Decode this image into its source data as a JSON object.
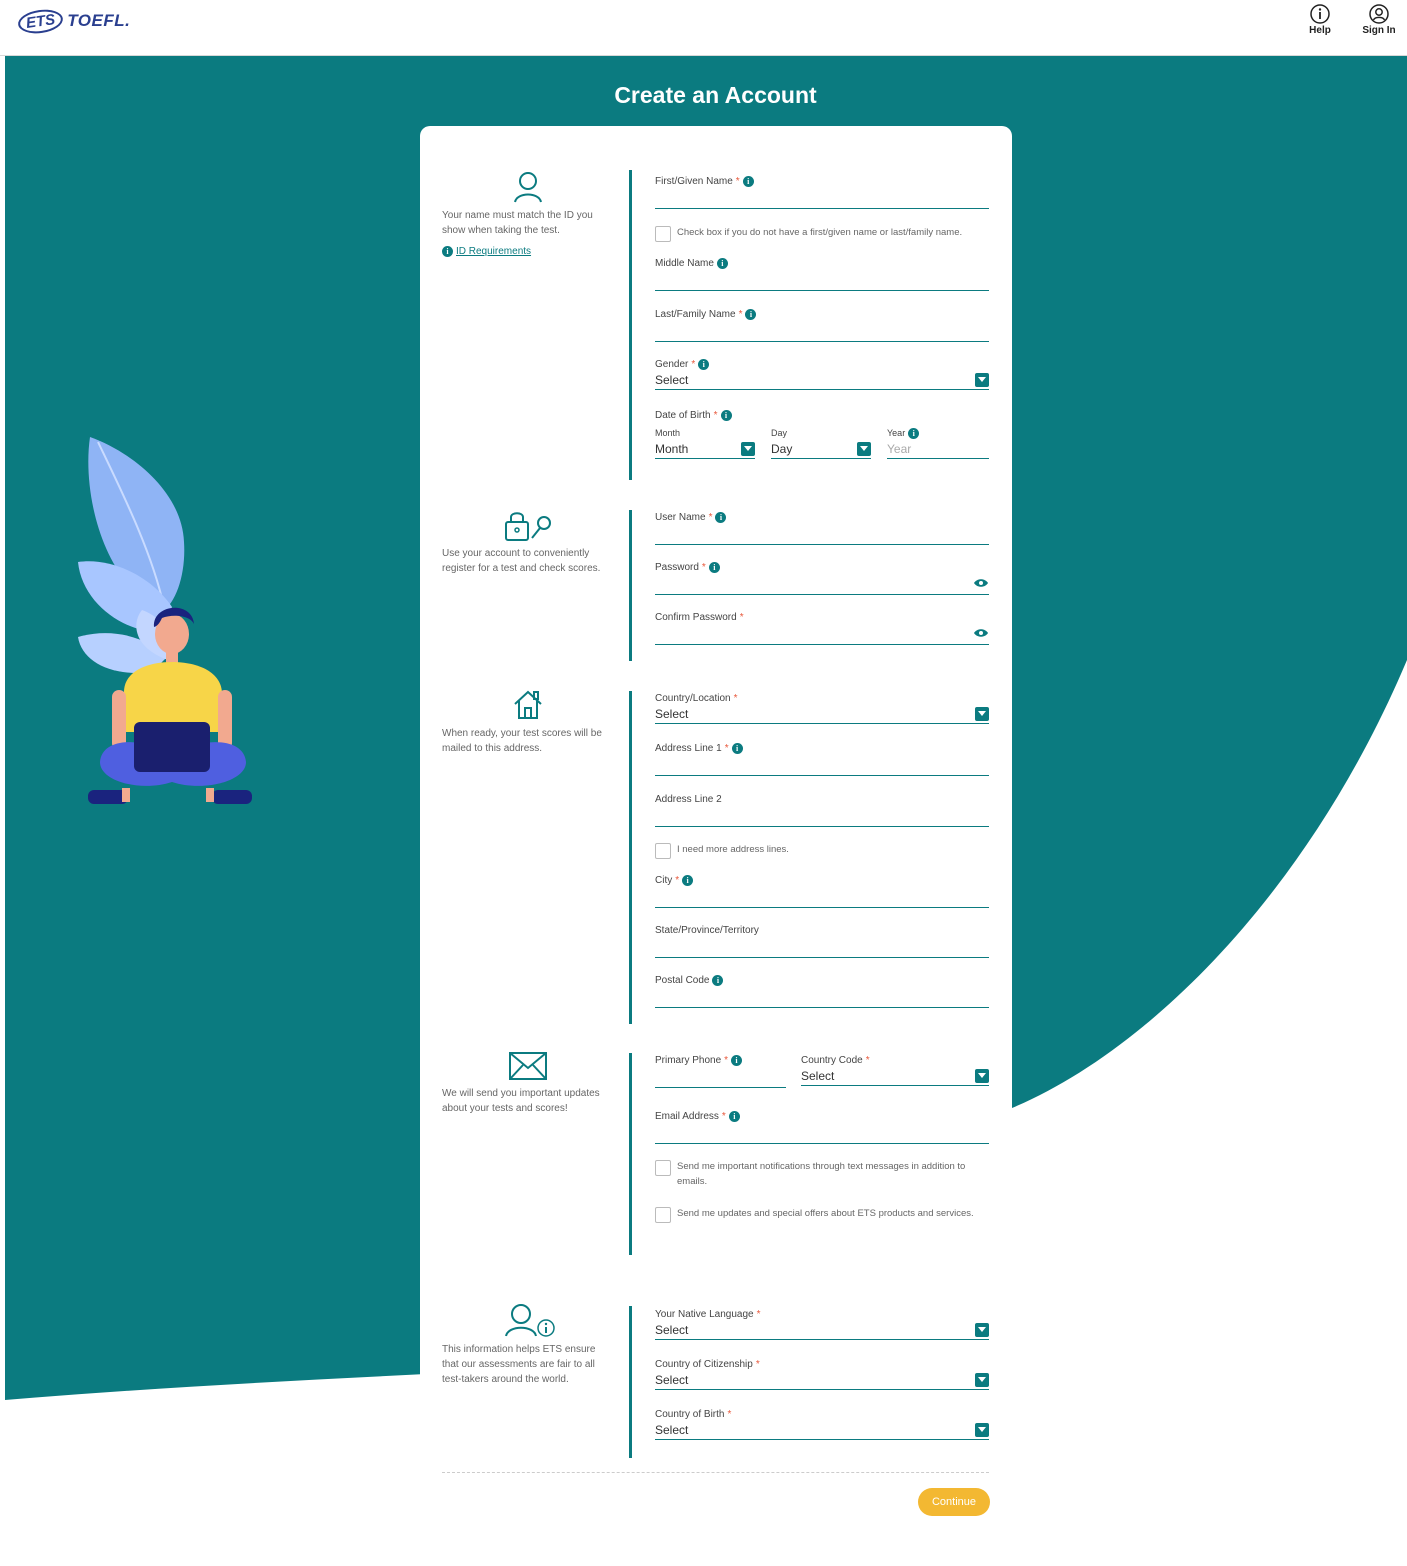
{
  "header": {
    "logo_ets": "ETS",
    "logo_toefl": "TOEFL.",
    "help_label": "Help",
    "signin_label": "Sign In"
  },
  "page_title": "Create an Account",
  "colors": {
    "teal": "#0b7b80",
    "accent": "#f3b832",
    "required": "#e8573a"
  },
  "sections": {
    "name": {
      "icon": "person-icon",
      "description": "Your name must match the ID you show when taking the test.",
      "link": "ID Requirements",
      "first_name_label": "First/Given Name",
      "no_first_name_check": "Check box if you do not have a first/given name or last/family name.",
      "middle_name_label": "Middle Name",
      "last_name_label": "Last/Family Name",
      "gender_label": "Gender",
      "gender_value": "Select",
      "dob_label": "Date of Birth",
      "month_label": "Month",
      "month_value": "Month",
      "day_label": "Day",
      "day_value": "Day",
      "year_label": "Year",
      "year_placeholder": "Year"
    },
    "account": {
      "icon": "lock-key-icon",
      "description": "Use your account to conveniently register for a test and check scores.",
      "username_label": "User Name",
      "password_label": "Password",
      "confirm_password_label": "Confirm Password"
    },
    "address": {
      "icon": "house-icon",
      "description": "When ready, your test scores will be mailed to this address.",
      "country_label": "Country/Location",
      "country_value": "Select",
      "address1_label": "Address Line 1",
      "address2_label": "Address Line 2",
      "more_lines_check": "I need more address lines.",
      "city_label": "City",
      "state_label": "State/Province/Territory",
      "postal_label": "Postal Code"
    },
    "contact": {
      "icon": "envelope-icon",
      "description": "We will send you important updates about your tests and scores!",
      "phone_label": "Primary Phone",
      "country_code_label": "Country Code",
      "country_code_value": "Select",
      "email_label": "Email Address",
      "sms_check": "Send me important notifications through text messages in addition to emails.",
      "offers_check": "Send me updates and special offers about ETS products and services."
    },
    "background": {
      "icon": "person-info-icon",
      "description": "This information helps ETS ensure that our assessments are fair to all test-takers around the world.",
      "native_language_label": "Your Native Language",
      "native_language_value": "Select",
      "citizenship_label": "Country of Citizenship",
      "citizenship_value": "Select",
      "birth_country_label": "Country of Birth",
      "birth_country_value": "Select"
    }
  },
  "continue_label": "Continue"
}
